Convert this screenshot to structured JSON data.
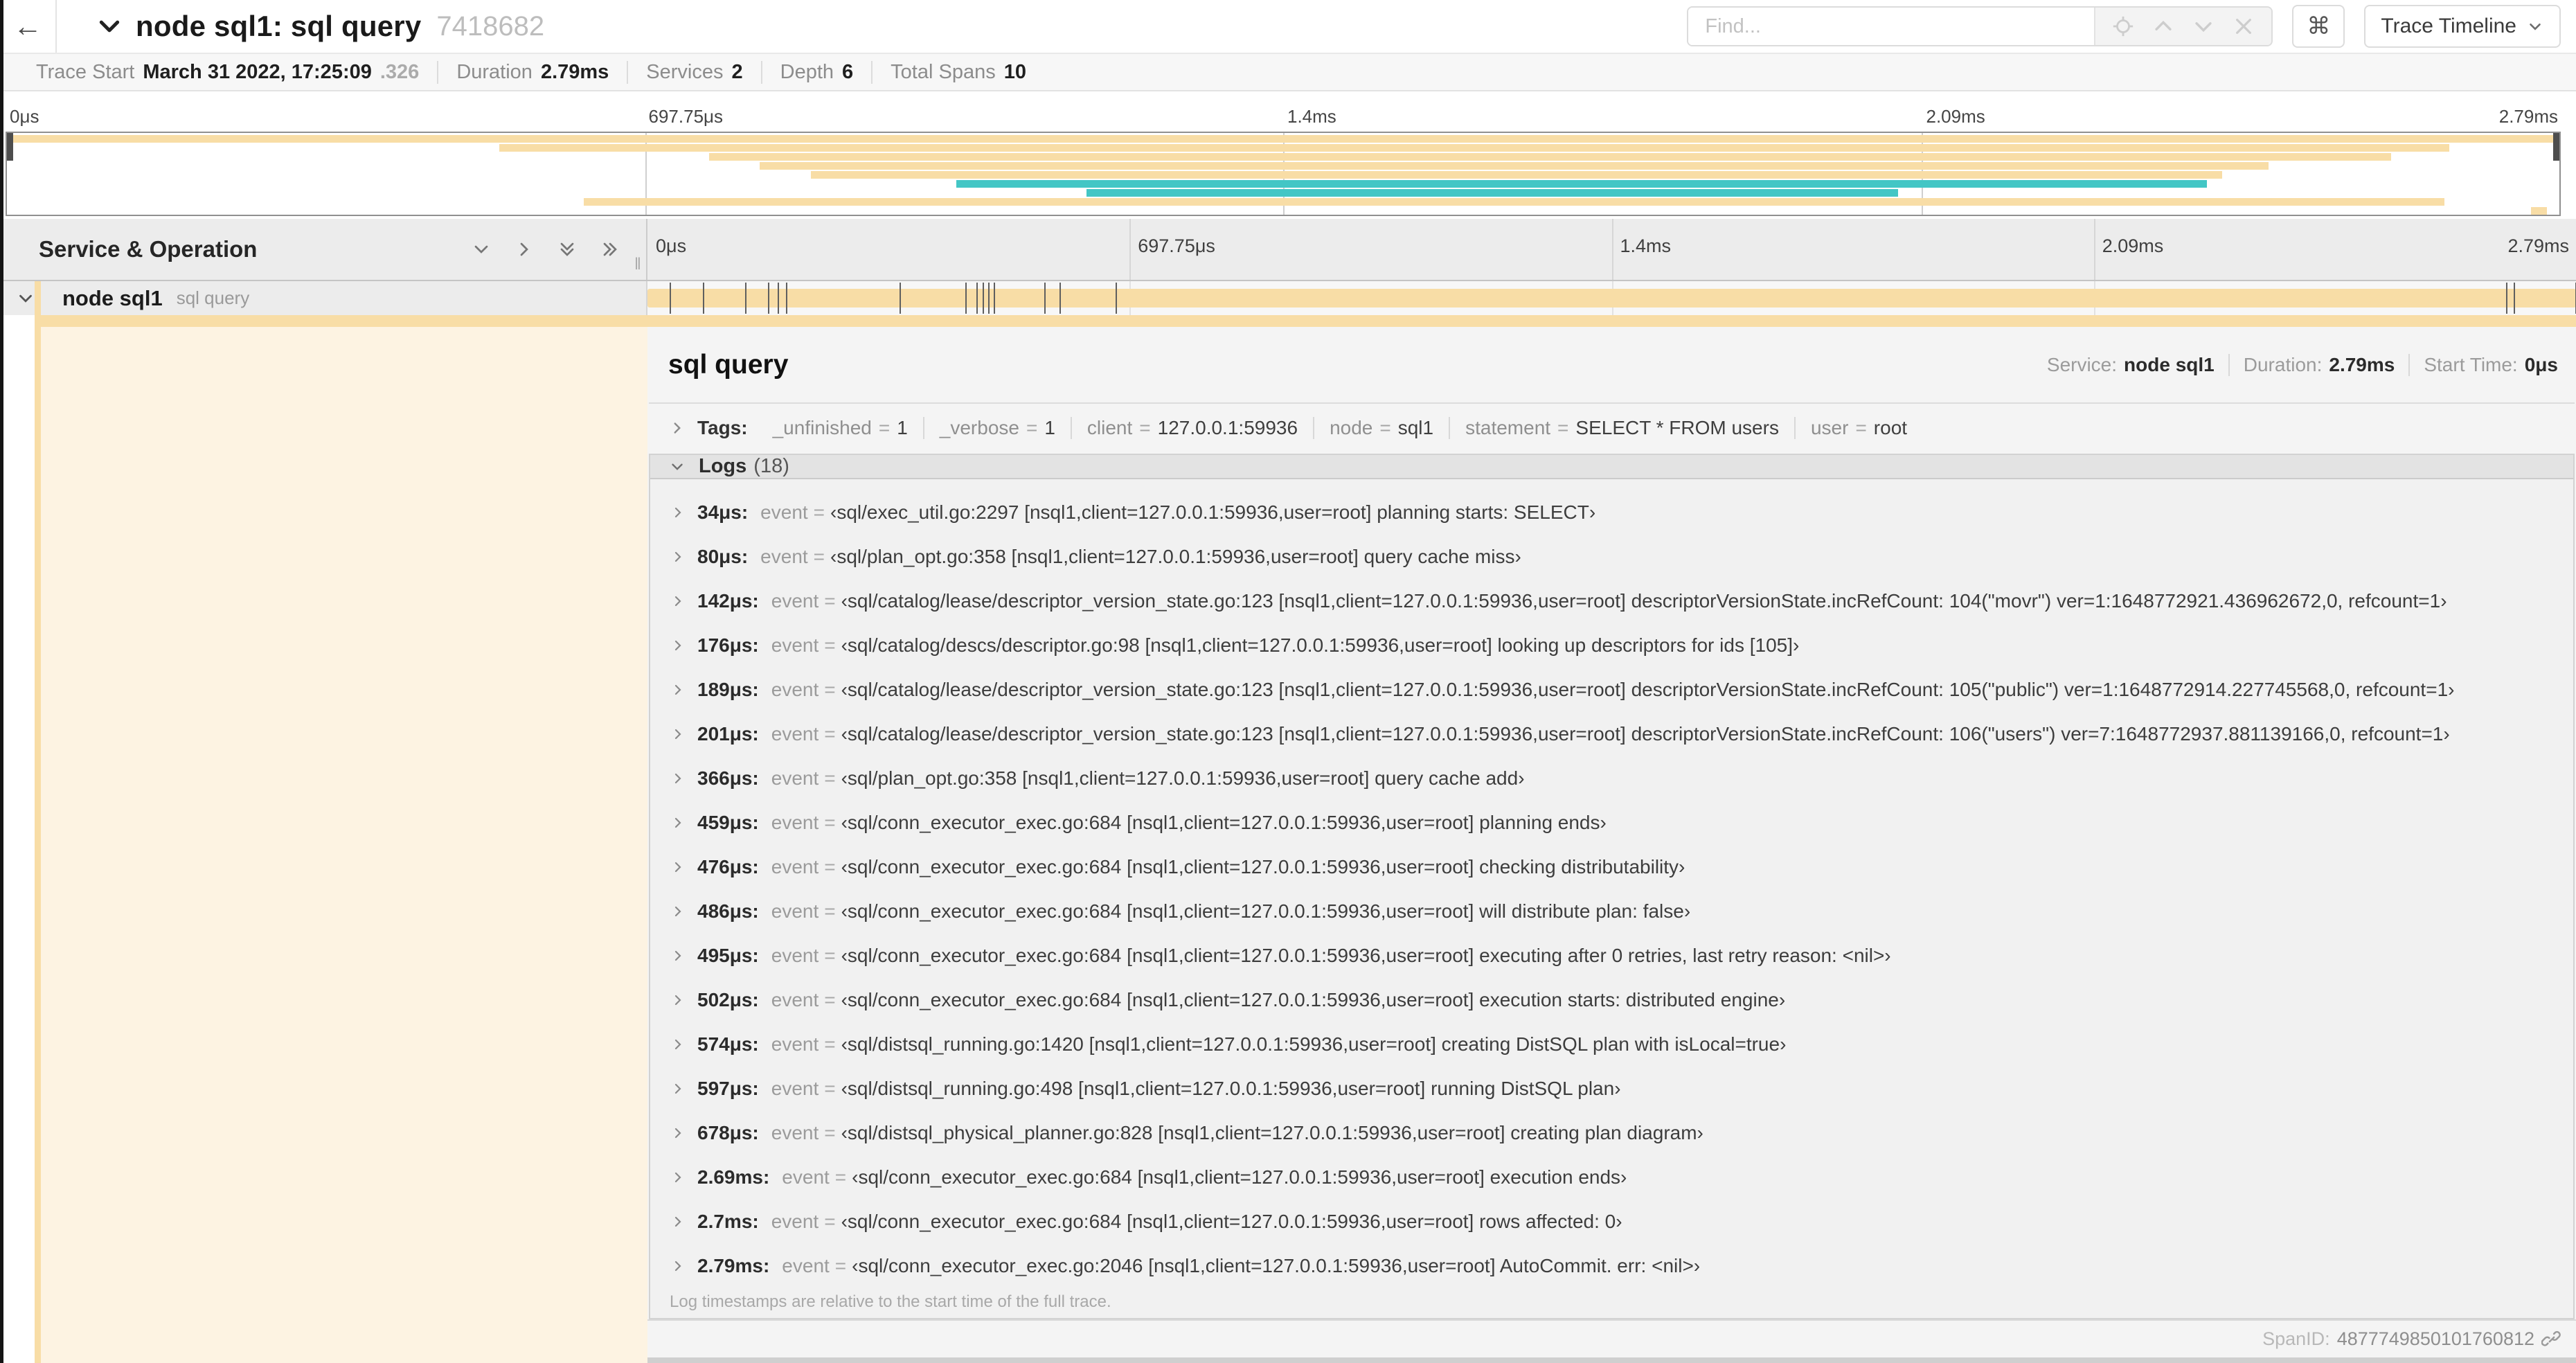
{
  "colors": {
    "span_tan": "#f8dda6",
    "span_teal": "#43c6c5",
    "detail_tint": "#fdf3e2"
  },
  "header": {
    "back_icon": "arrow-left",
    "title": "node sql1: sql query",
    "trace_id": "7418682",
    "find_placeholder": "Find...",
    "shortcut_icon": "⌘",
    "view_selector": "Trace Timeline"
  },
  "info_bar": {
    "items": [
      {
        "label": "Trace Start",
        "value": "March 31 2022, 17:25:09",
        "suffix": ".326"
      },
      {
        "label": "Duration",
        "value": "2.79ms"
      },
      {
        "label": "Services",
        "value": "2"
      },
      {
        "label": "Depth",
        "value": "6"
      },
      {
        "label": "Total Spans",
        "value": "10"
      }
    ]
  },
  "minimap": {
    "tick_labels": [
      "0μs",
      "697.75μs",
      "1.4ms",
      "2.09ms",
      "2.79ms"
    ],
    "spans": [
      {
        "start": 0,
        "end": 99.8,
        "color": "tan"
      },
      {
        "start": 19.3,
        "end": 95.7,
        "color": "tan"
      },
      {
        "start": 27.5,
        "end": 93.4,
        "color": "tan"
      },
      {
        "start": 29.5,
        "end": 88.6,
        "color": "tan"
      },
      {
        "start": 31.5,
        "end": 86.8,
        "color": "tan"
      },
      {
        "start": 37.2,
        "end": 86.2,
        "color": "teal"
      },
      {
        "start": 42.3,
        "end": 74.1,
        "color": "teal"
      },
      {
        "start": 22.6,
        "end": 95.5,
        "color": "tan"
      },
      {
        "start": 98.9,
        "end": 99.5,
        "color": "tan"
      }
    ]
  },
  "timeline": {
    "column_title": "Service & Operation",
    "tick_labels": [
      "0μs",
      "697.75μs",
      "1.4ms",
      "2.09ms",
      "2.79ms"
    ],
    "row": {
      "service": "node sql1",
      "operation": "sql query",
      "bar_start": 0,
      "bar_end": 100,
      "log_ticks": [
        1.2,
        2.9,
        5.1,
        6.3,
        6.8,
        7.2,
        13.1,
        16.5,
        17.1,
        17.4,
        17.7,
        18.0,
        20.6,
        21.4,
        24.3,
        96.4,
        96.8,
        100
      ]
    }
  },
  "detail": {
    "title": "sql query",
    "meta": [
      {
        "label": "Service:",
        "value": "node sql1"
      },
      {
        "label": "Duration:",
        "value": "2.79ms"
      },
      {
        "label": "Start Time:",
        "value": "0μs"
      }
    ],
    "tags_label": "Tags:",
    "tags": [
      {
        "key": "_unfinished",
        "value": "1"
      },
      {
        "key": "_verbose",
        "value": "1"
      },
      {
        "key": "client",
        "value": "127.0.0.1:59936"
      },
      {
        "key": "node",
        "value": "sql1"
      },
      {
        "key": "statement",
        "value": "SELECT * FROM users"
      },
      {
        "key": "user",
        "value": "root"
      }
    ],
    "logs_label": "Logs",
    "logs_count": "(18)",
    "logs": [
      {
        "time": "34μs",
        "key": "event",
        "value": "‹sql/exec_util.go:2297 [nsql1,client=127.0.0.1:59936,user=root] planning starts: SELECT›"
      },
      {
        "time": "80μs",
        "key": "event",
        "value": "‹sql/plan_opt.go:358 [nsql1,client=127.0.0.1:59936,user=root] query cache miss›"
      },
      {
        "time": "142μs",
        "key": "event",
        "value": "‹sql/catalog/lease/descriptor_version_state.go:123 [nsql1,client=127.0.0.1:59936,user=root] descriptorVersionState.incRefCount: 104(\"movr\") ver=1:1648772921.436962672,0, refcount=1›"
      },
      {
        "time": "176μs",
        "key": "event",
        "value": "‹sql/catalog/descs/descriptor.go:98 [nsql1,client=127.0.0.1:59936,user=root] looking up descriptors for ids [105]›"
      },
      {
        "time": "189μs",
        "key": "event",
        "value": "‹sql/catalog/lease/descriptor_version_state.go:123 [nsql1,client=127.0.0.1:59936,user=root] descriptorVersionState.incRefCount: 105(\"public\") ver=1:1648772914.227745568,0, refcount=1›"
      },
      {
        "time": "201μs",
        "key": "event",
        "value": "‹sql/catalog/lease/descriptor_version_state.go:123 [nsql1,client=127.0.0.1:59936,user=root] descriptorVersionState.incRefCount: 106(\"users\") ver=7:1648772937.881139166,0, refcount=1›"
      },
      {
        "time": "366μs",
        "key": "event",
        "value": "‹sql/plan_opt.go:358 [nsql1,client=127.0.0.1:59936,user=root] query cache add›"
      },
      {
        "time": "459μs",
        "key": "event",
        "value": "‹sql/conn_executor_exec.go:684 [nsql1,client=127.0.0.1:59936,user=root] planning ends›"
      },
      {
        "time": "476μs",
        "key": "event",
        "value": "‹sql/conn_executor_exec.go:684 [nsql1,client=127.0.0.1:59936,user=root] checking distributability›"
      },
      {
        "time": "486μs",
        "key": "event",
        "value": "‹sql/conn_executor_exec.go:684 [nsql1,client=127.0.0.1:59936,user=root] will distribute plan: false›"
      },
      {
        "time": "495μs",
        "key": "event",
        "value": "‹sql/conn_executor_exec.go:684 [nsql1,client=127.0.0.1:59936,user=root] executing after 0 retries, last retry reason: <nil>›"
      },
      {
        "time": "502μs",
        "key": "event",
        "value": "‹sql/conn_executor_exec.go:684 [nsql1,client=127.0.0.1:59936,user=root] execution starts: distributed engine›"
      },
      {
        "time": "574μs",
        "key": "event",
        "value": "‹sql/distsql_running.go:1420 [nsql1,client=127.0.0.1:59936,user=root] creating DistSQL plan with isLocal=true›"
      },
      {
        "time": "597μs",
        "key": "event",
        "value": "‹sql/distsql_running.go:498 [nsql1,client=127.0.0.1:59936,user=root] running DistSQL plan›"
      },
      {
        "time": "678μs",
        "key": "event",
        "value": "‹sql/distsql_physical_planner.go:828 [nsql1,client=127.0.0.1:59936,user=root] creating plan diagram›"
      },
      {
        "time": "2.69ms",
        "key": "event",
        "value": "‹sql/conn_executor_exec.go:684 [nsql1,client=127.0.0.1:59936,user=root] execution ends›"
      },
      {
        "time": "2.7ms",
        "key": "event",
        "value": "‹sql/conn_executor_exec.go:684 [nsql1,client=127.0.0.1:59936,user=root] rows affected: 0›"
      },
      {
        "time": "2.79ms",
        "key": "event",
        "value": "‹sql/conn_executor_exec.go:2046 [nsql1,client=127.0.0.1:59936,user=root] AutoCommit. err: <nil>›"
      }
    ],
    "note": "Log timestamps are relative to the start time of the full trace.",
    "span_id_label": "SpanID:",
    "span_id_value": "4877749850101760812"
  }
}
